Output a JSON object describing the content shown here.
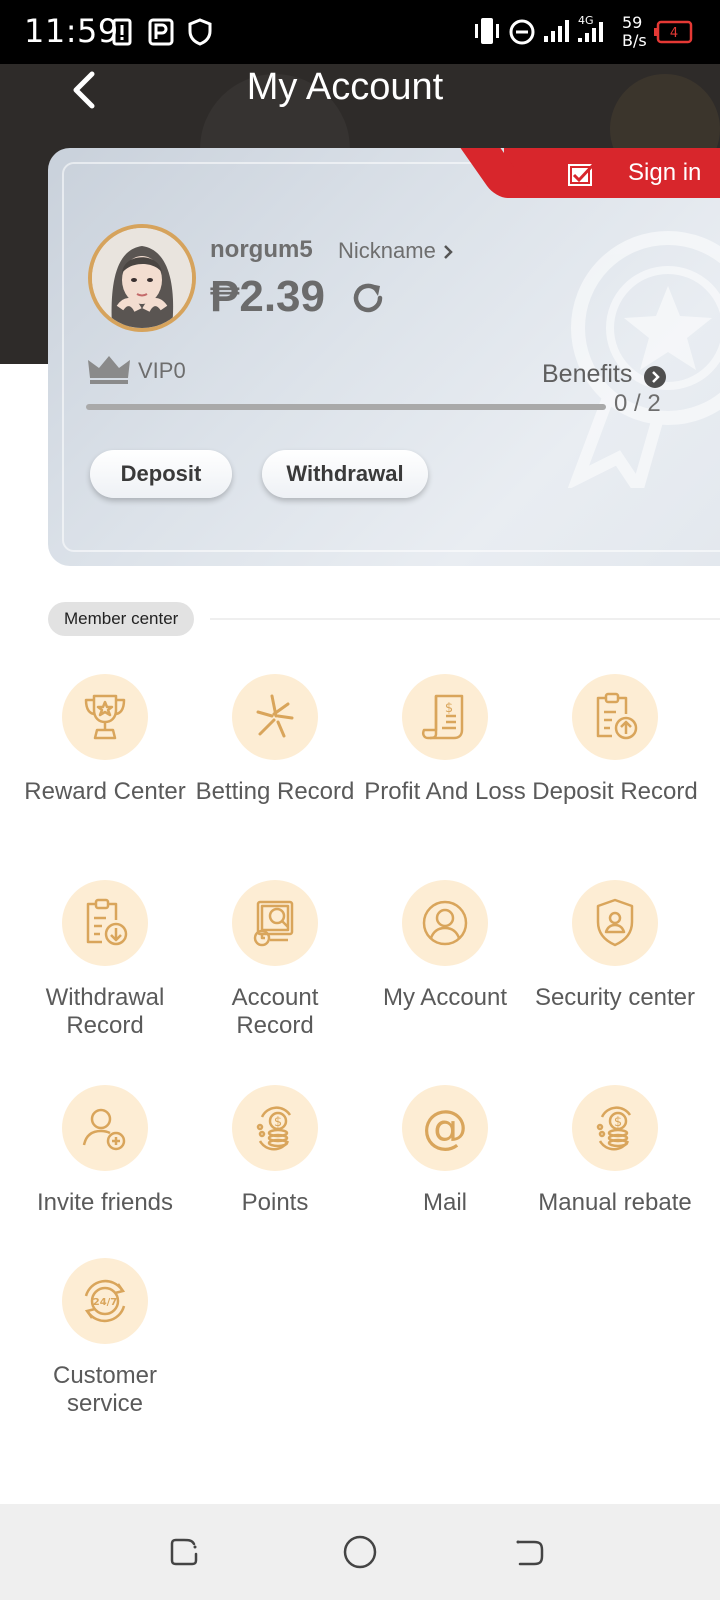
{
  "status_bar": {
    "time": "11:59",
    "speed_value": "59",
    "speed_unit": "B/s",
    "battery_level": "4",
    "network_type": "4G"
  },
  "header": {
    "title": "My Account",
    "back_icon": "chevron-left-icon"
  },
  "account_card": {
    "sign_in_label": "Sign in",
    "username": "norgum5",
    "nickname_label": "Nickname",
    "balance": "₱2.39",
    "vip_level": "VIP0",
    "benefits_label": "Benefits",
    "progress_text": "0 / 2",
    "progress_fraction": 0,
    "deposit_label": "Deposit",
    "withdrawal_label": "Withdrawal"
  },
  "member_center": {
    "label": "Member center",
    "items": [
      {
        "label": "Reward Center",
        "icon": "trophy-icon"
      },
      {
        "label": "Betting Record",
        "icon": "betting-record-icon"
      },
      {
        "label": "Profit And Loss",
        "icon": "receipt-dollar-icon"
      },
      {
        "label": "Deposit Record",
        "icon": "deposit-record-icon"
      },
      {
        "label": "Withdrawal Record",
        "icon": "withdrawal-record-icon"
      },
      {
        "label": "Account Record",
        "icon": "account-record-icon"
      },
      {
        "label": "My Account",
        "icon": "user-icon"
      },
      {
        "label": "Security center",
        "icon": "shield-user-icon"
      },
      {
        "label": "Invite friends",
        "icon": "add-user-icon"
      },
      {
        "label": "Points",
        "icon": "coins-icon"
      },
      {
        "label": "Mail",
        "icon": "at-sign-icon"
      },
      {
        "label": "Manual rebate",
        "icon": "rebate-coins-icon"
      },
      {
        "label": "Customer service",
        "icon": "support-24-7-icon"
      }
    ]
  },
  "colors": {
    "accent_gold": "#d6a35c",
    "icon_bg": "#fdedd4",
    "sign_in_red": "#d8262c",
    "header_dark": "#2e2b29"
  }
}
